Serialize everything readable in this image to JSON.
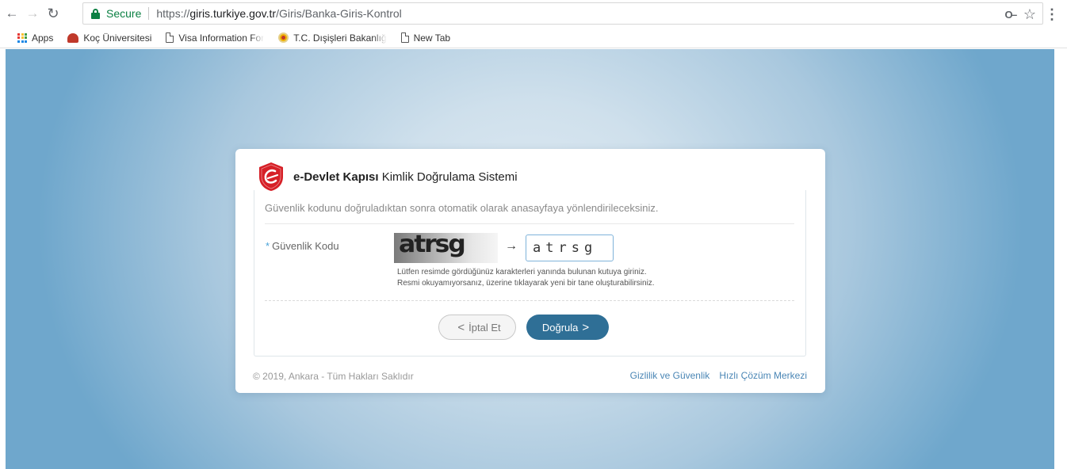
{
  "browser": {
    "secure_label": "Secure",
    "url_scheme": "https://",
    "url_host": "giris.turkiye.gov.tr",
    "url_path": "/Giris/Banka-Giris-Kontrol",
    "bookmarks": [
      {
        "label": "Apps",
        "icon": "apps-grid-icon"
      },
      {
        "label": "Koç Üniversitesi",
        "icon": "koc-logo-icon"
      },
      {
        "label": "Visa Information For",
        "icon": "page-icon"
      },
      {
        "label": "T.C. Dışişleri Bakanlığ",
        "icon": "tc-emblem-icon"
      },
      {
        "label": "New Tab",
        "icon": "page-icon"
      }
    ]
  },
  "page": {
    "brand_bold": "e-Devlet Kapısı",
    "brand_rest": " Kimlik Doğrulama Sistemi",
    "info_text": "Güvenlik kodunu doğruladıktan sonra otomatik olarak anasayfaya yönlendirileceksiniz.",
    "required_mark": "*",
    "field_label": "Güvenlik Kodu",
    "captcha_text": "atrsg",
    "arrow": "→",
    "code_value": "atrsg",
    "hint_line1": "Lütfen resimde gördüğünüz karakterleri yanında bulunan kutuya giriniz.",
    "hint_line2": "Resmi okuyamıyorsanız, üzerine tıklayarak yeni bir tane oluşturabilirsiniz.",
    "cancel_label": "İptal Et",
    "confirm_label": "Doğrula",
    "copyright": "© 2019, Ankara - Tüm Hakları Saklıdır",
    "link_privacy": "Gizlilik ve Güvenlik",
    "link_help": "Hızlı Çözüm Merkezi"
  },
  "colors": {
    "brand_red": "#d62027",
    "primary_button": "#2f6f96",
    "link": "#4a86b5"
  }
}
